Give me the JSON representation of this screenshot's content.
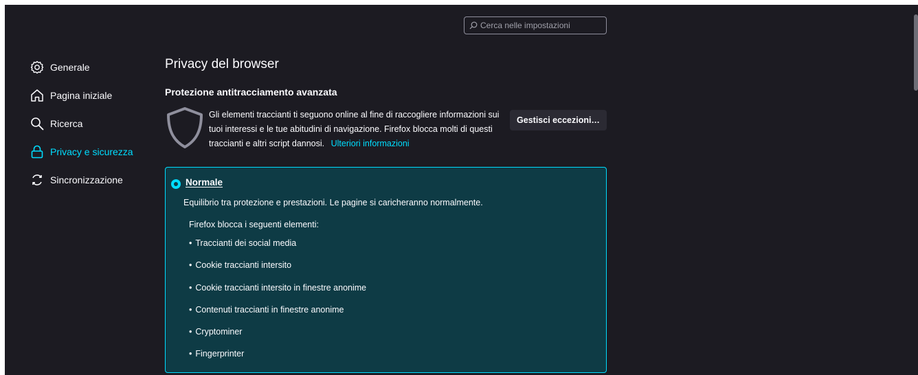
{
  "search": {
    "placeholder": "Cerca nelle impostazioni"
  },
  "sidebar": {
    "items": [
      {
        "label": "Generale",
        "icon": "gear-icon",
        "active": false
      },
      {
        "label": "Pagina iniziale",
        "icon": "home-icon",
        "active": false
      },
      {
        "label": "Ricerca",
        "icon": "search-icon",
        "active": false
      },
      {
        "label": "Privacy e sicurezza",
        "icon": "lock-icon",
        "active": true
      },
      {
        "label": "Sincronizzazione",
        "icon": "sync-icon",
        "active": false
      }
    ]
  },
  "main": {
    "page_title": "Privacy del browser",
    "section_title": "Protezione antitracciamento avanzata",
    "description": "Gli elementi traccianti ti seguono online al fine di raccogliere informazioni sui tuoi interessi e le tue abitudini di navigazione. Firefox blocca molti di questi traccianti e altri script dannosi.",
    "learn_more": "Ulteriori informazioni",
    "manage_button": "Gestisci eccezioni…",
    "option": {
      "label": "Normale",
      "selected": true,
      "description": "Equilibrio tra protezione e prestazioni. Le pagine si caricheranno normalmente.",
      "blocks_title": "Firefox blocca i seguenti elementi:",
      "blocks": [
        "Traccianti dei social media",
        "Cookie traccianti intersito",
        "Cookie traccianti intersito in finestre anonime",
        "Contenuti traccianti in finestre anonime",
        "Cryptominer",
        "Fingerprinter"
      ]
    }
  },
  "colors": {
    "background": "#1c1b22",
    "accent": "#00ddff",
    "card_background": "#0e3b45",
    "text": "#fbfbfe"
  }
}
